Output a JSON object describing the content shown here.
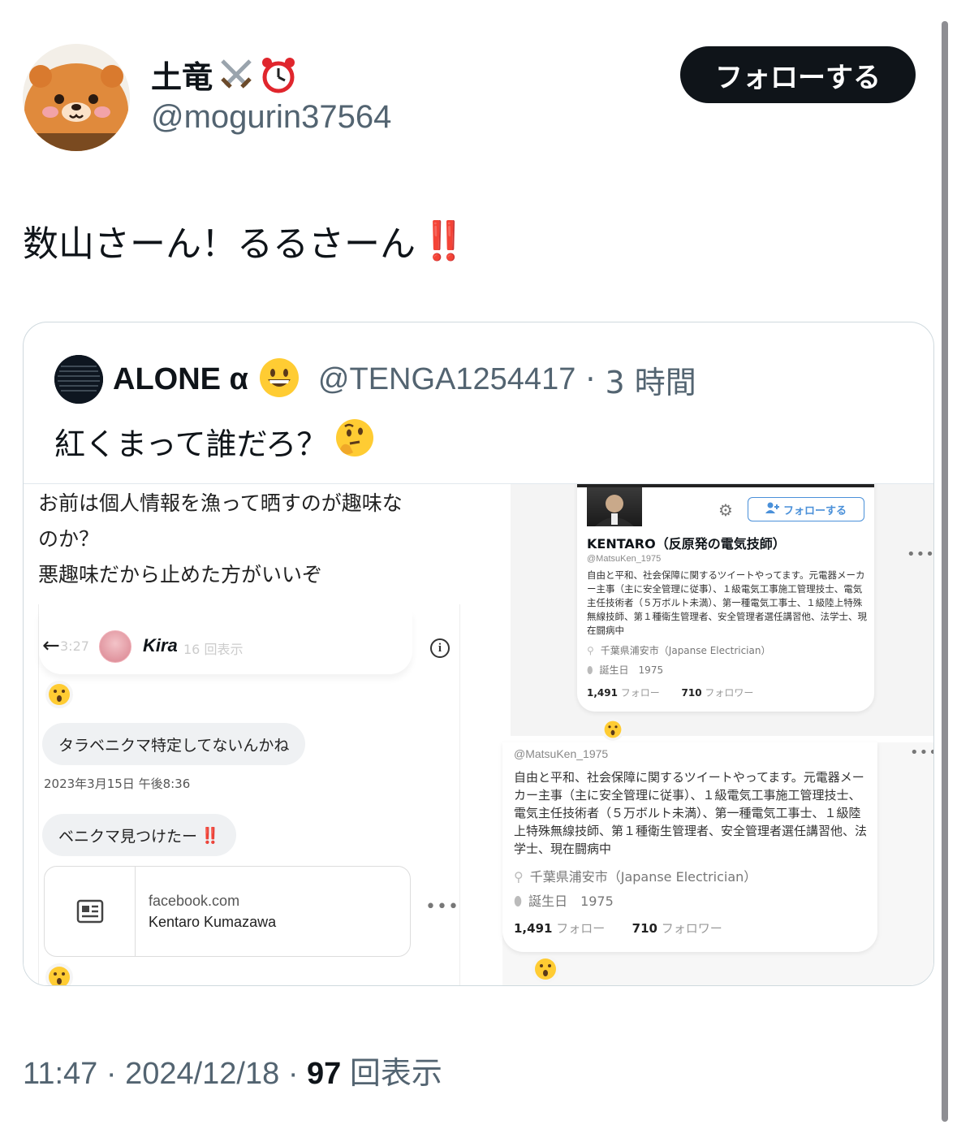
{
  "header": {
    "display_name": "土竜",
    "handle": "@mogurin37564",
    "follow_label": "フォローする"
  },
  "tweet": {
    "text": "数山さーん！るるさーん",
    "emphasis": "‼️"
  },
  "quote": {
    "display_name": "ALONE α",
    "handle": "@TENGA1254417",
    "separator": "·",
    "time": "3 時間",
    "text": "紅くまって誰だろ？"
  },
  "media": {
    "left_text_lines": [
      "お前は個人情報を漁って晒すのが趣味な",
      "のか？",
      "悪趣味だから止めた方がいいぞ"
    ],
    "dm": {
      "chat_name": "Kira",
      "ghost_time": "3:27",
      "ghost_views": "16 回表示",
      "message_1": "タラベニクマ特定してないんかね",
      "timestamp": "2023年3月15日 午後8:36",
      "message_2": "ベニクマ見つけたー",
      "message_2_emphasis": "‼️",
      "link_domain": "facebook.com",
      "link_title": "Kentaro Kumazawa"
    },
    "profile_card_1": {
      "follow_label": "フォローする",
      "name": "KENTARO（反原発の電気技師）",
      "handle": "@MatsuKen_1975",
      "bio": "自由と平和、社会保障に関するツイートやってます。元電器メーカー主事（主に安全管理に従事）、１級電気工事施工管理技士、電気主任技術者（５万ボルト未満）、第一種電気工事士、１級陸上特殊無線技師、第１種衛生管理者、安全管理者選任講習他、法学士、現在闘病中",
      "location": "千葉県浦安市（Japanse Electrician）",
      "birth": "誕生日　1975",
      "following_count": "1,491",
      "following_label": "フォロー",
      "followers_count": "710",
      "followers_label": "フォロワー"
    },
    "profile_card_2": {
      "handle": "@MatsuKen_1975",
      "bio": "自由と平和、社会保障に関するツイートやってます。元電器メーカー主事（主に安全管理に従事）、１級電気工事施工管理技士、電気主任技術者（５万ボルト未満）、第一種電気工事士、１級陸上特殊無線技師、第１種衛生管理者、安全管理者選任講習他、法学士、現在闘病中",
      "location": "千葉県浦安市（Japanse Electrician）",
      "birth": "誕生日　1975",
      "following_count": "1,491",
      "following_label": "フォロー",
      "followers_count": "710",
      "followers_label": "フォロワー"
    }
  },
  "footer": {
    "time": "11:47",
    "date": "2024/12/18",
    "views_count": "97",
    "views_label": "回表示"
  },
  "icons": [
    "mole-avatar",
    "crossed-swords-icon",
    "alarm-clock-icon",
    "double-exclamation-icon",
    "grinning-face-icon",
    "thinking-face-icon",
    "surprised-face-icon",
    "back-arrow-icon",
    "info-icon",
    "gear-icon",
    "add-user-icon",
    "article-icon",
    "location-pin-icon",
    "balloon-icon",
    "more-icon"
  ],
  "colors": {
    "follow_button_bg": "#0f1419",
    "secondary_text": "#536471",
    "emphasis_red": "#e0262d",
    "link_blue": "#4a90d9"
  }
}
